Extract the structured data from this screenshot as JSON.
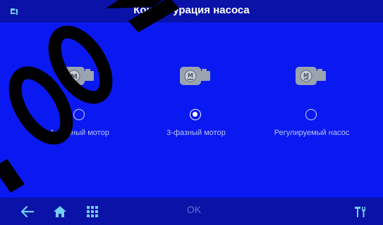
{
  "header": {
    "title": "Конфигурация насоса",
    "logo_icon": "brand-logo-icon"
  },
  "options": [
    {
      "label": "1-фазный мотор",
      "icon": "single-phase-motor-icon",
      "selected": false
    },
    {
      "label": "3-фазный мотор",
      "icon": "three-phase-motor-icon",
      "selected": true
    },
    {
      "label": "Регулируемый насос",
      "icon": "variable-pump-icon",
      "selected": false
    }
  ],
  "footer": {
    "back_icon": "arrow-left-icon",
    "home_icon": "home-icon",
    "menu_icon": "grid-menu-icon",
    "ok_label": "OK",
    "tools_icon": "tools-icon"
  },
  "colors": {
    "background": "#0a19f2",
    "bar": "#0a12a8",
    "accent_icon": "#6fd0f0",
    "label": "#b7c2ee",
    "ok_disabled": "#6670c8",
    "watermark": "#000000"
  }
}
